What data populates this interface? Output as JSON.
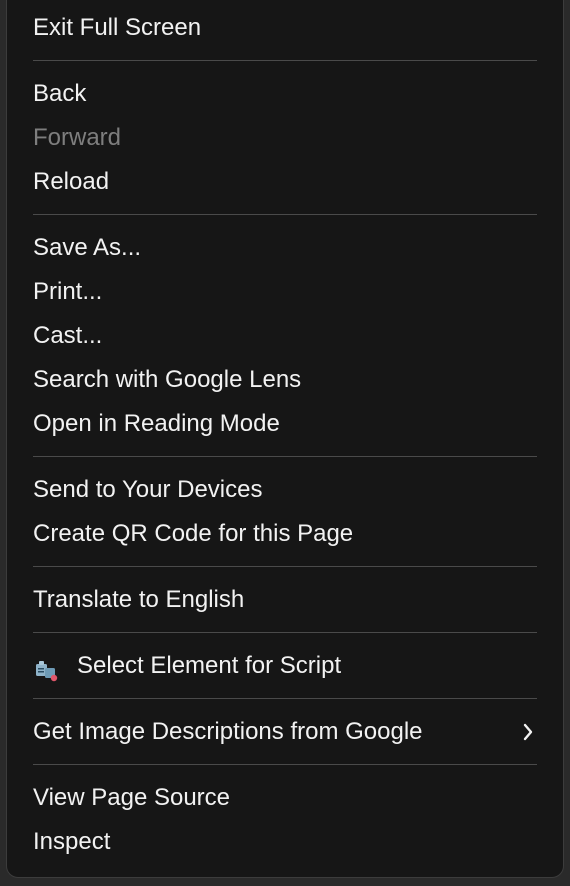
{
  "menu": {
    "items": {
      "exit_full_screen": "Exit Full Screen",
      "back": "Back",
      "forward": "Forward",
      "reload": "Reload",
      "save_as": "Save As...",
      "print": "Print...",
      "cast": "Cast...",
      "search_google_lens": "Search with Google Lens",
      "open_reading_mode": "Open in Reading Mode",
      "send_to_devices": "Send to Your Devices",
      "create_qr_code": "Create QR Code for this Page",
      "translate": "Translate to English",
      "select_element_script": "Select Element for Script",
      "get_image_descriptions": "Get Image Descriptions from Google",
      "view_page_source": "View Page Source",
      "inspect": "Inspect"
    },
    "icons": {
      "select_element_script": "extension-script-icon",
      "get_image_descriptions": "chevron-right-icon"
    },
    "colors": {
      "background": "#161616",
      "text": "#f2f2f2",
      "disabled_text": "#7e7e7e",
      "separator": "#4a4a4a"
    }
  }
}
